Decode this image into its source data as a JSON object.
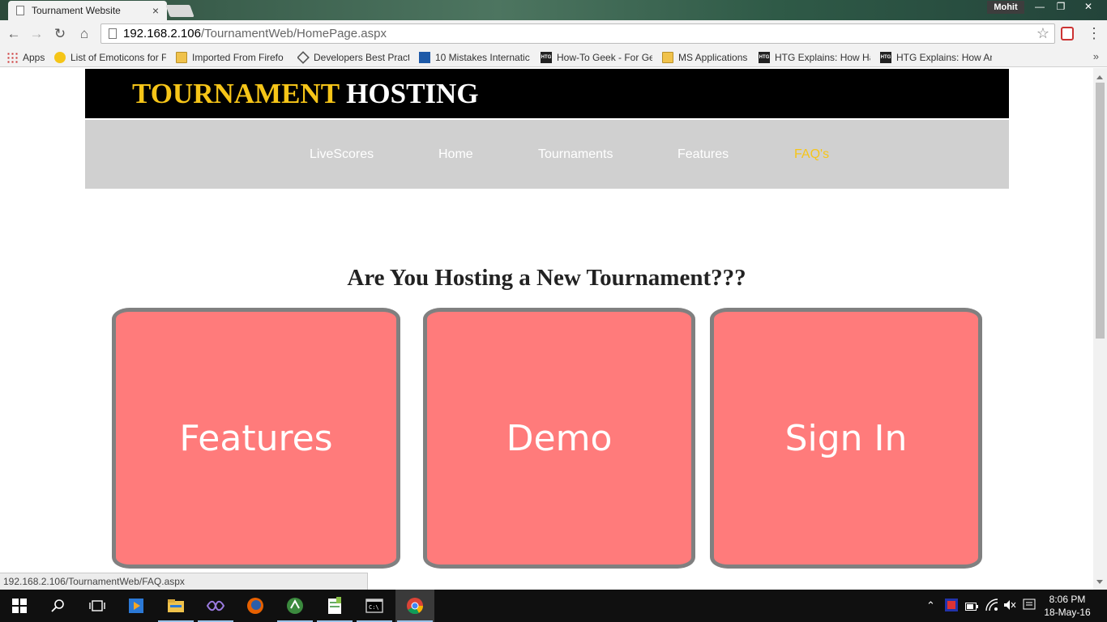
{
  "browser": {
    "tab_title": "Tournament Website",
    "tab_close": "×",
    "user_badge": "Mohit",
    "url_host": "192.168.2.106",
    "url_path": "/TournamentWeb/HomePage.aspx",
    "bookmarks": [
      {
        "label": "Apps",
        "icon": "apps-grid-icon"
      },
      {
        "label": "List of Emoticons for F",
        "icon": "smiley-icon"
      },
      {
        "label": "Imported From Firefo",
        "icon": "folder-icon"
      },
      {
        "label": "Developers Best Pract",
        "icon": "diamond-icon"
      },
      {
        "label": "10 Mistakes Internatic",
        "icon": "s-logo-icon"
      },
      {
        "label": "How-To Geek - For Ge",
        "icon": "htg-icon"
      },
      {
        "label": "MS Applications",
        "icon": "folder-icon"
      },
      {
        "label": "HTG Explains: How Ha",
        "icon": "htg-icon"
      },
      {
        "label": "HTG Explains: How An",
        "icon": "htg-icon"
      }
    ],
    "status_url": "192.168.2.106/TournamentWeb/FAQ.aspx"
  },
  "site": {
    "brand_part1": "TOURNAMENT",
    "brand_part2": "HOSTING",
    "nav": [
      {
        "label": "LiveScores",
        "active": false
      },
      {
        "label": "Home",
        "active": false
      },
      {
        "label": "Tournaments",
        "active": false
      },
      {
        "label": "Features",
        "active": false
      },
      {
        "label": "FAQ's",
        "active": true
      }
    ],
    "hero_title": "Are You Hosting a New Tournament???",
    "cards": [
      "Features",
      "Demo",
      "Sign In"
    ]
  },
  "taskbar": {
    "time": "8:06 PM",
    "date": "18-May-16"
  },
  "colors": {
    "brand_yellow": "#f6c518",
    "card_fill": "#ff7b7b",
    "card_border": "#808080",
    "nav_bg": "#d0d0d0"
  }
}
